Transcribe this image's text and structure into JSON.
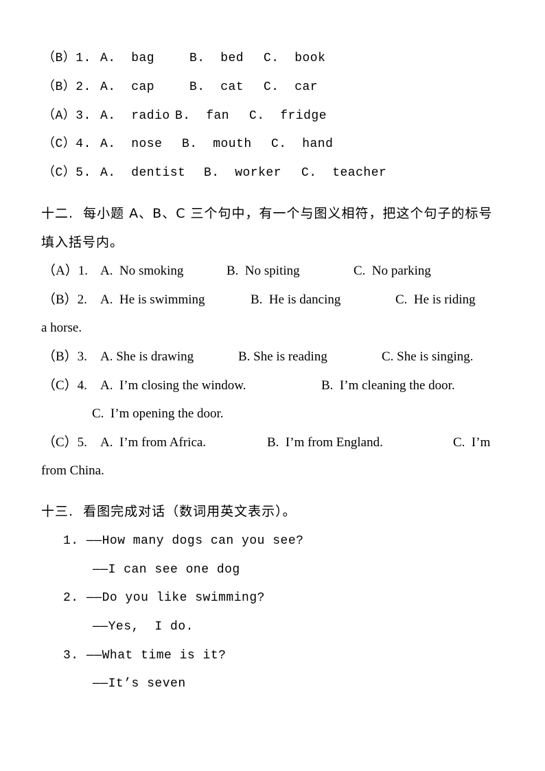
{
  "section11": {
    "items": [
      {
        "answer": "（B）1.",
        "a": "A.  bag",
        "b": "B.  bed",
        "c": "C.  book"
      },
      {
        "answer": "（B）2.",
        "a": "A.  cap",
        "b": "B.  cat",
        "c": "C.  car"
      },
      {
        "answer": "（A）3.",
        "a": "A.  radio",
        "b": "B.  fan",
        "c": "C.  fridge"
      },
      {
        "answer": "（C）4.",
        "a": "A.  nose",
        "b": "B.  mouth",
        "c": "C.  hand"
      },
      {
        "answer": "（C）5.",
        "a": "A.  dentist",
        "b": "B.  worker",
        "c": "C.  teacher"
      }
    ]
  },
  "section12": {
    "heading_line1": "十二.  每小题 A、B、C 三个句中，有一个与图义相符，把这个句子的标号",
    "heading_line2": "填入括号内。",
    "items": [
      {
        "answer": "（A）1.",
        "a": "A.  No smoking",
        "b": "B.  No spiting",
        "c": "C.  No parking"
      },
      {
        "answer": "（B）2.",
        "a": "A.  He is swimming",
        "b": "B.  He is dancing",
        "c": "C.  He is riding",
        "continuation": "a horse."
      },
      {
        "answer": "（B）3.",
        "a": "A. She is drawing",
        "b": "B. She is reading",
        "c": "C. She is singing."
      },
      {
        "answer": "（C）4.",
        "a": "A.  I’m closing the window.",
        "b": "B.  I’m cleaning the door.",
        "c": "C.  I’m opening the door."
      },
      {
        "answer": "（C）5.",
        "a": "A.  I’m from Africa.",
        "b": "B.  I’m from England.",
        "c": "C.  I’m",
        "continuation": "from China."
      }
    ]
  },
  "section13": {
    "heading": "十三.  看图完成对话（数词用英文表示）。",
    "dialogs": [
      {
        "number": "1.",
        "question": "——How many dogs can you see?",
        "answer": "——I can see one dog"
      },
      {
        "number": "2.",
        "question": "——Do you like swimming?",
        "answer": "——Yes,  I do."
      },
      {
        "number": "3.",
        "question": "——What time is it?",
        "answer": "——It’s seven"
      }
    ]
  }
}
